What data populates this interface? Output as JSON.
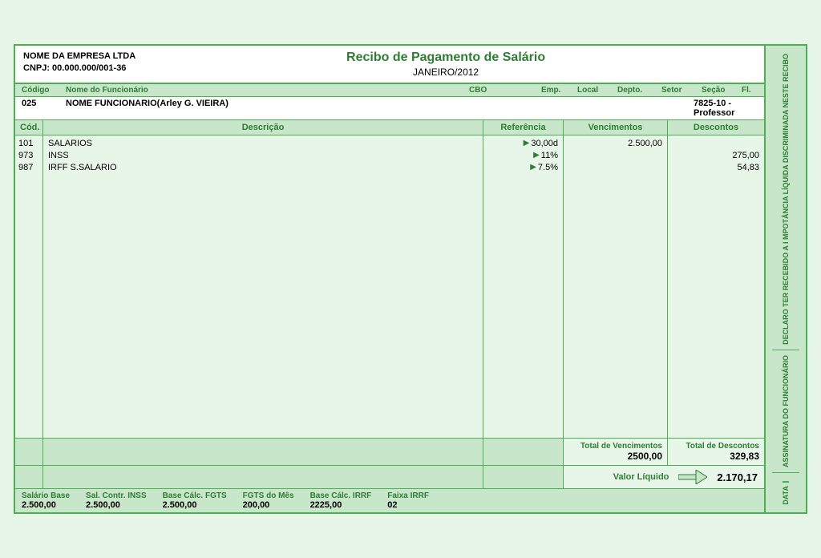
{
  "company": {
    "name": "NOME DA EMPRESA LTDA",
    "cnpj": "CNPJ: 00.000.000/001-36"
  },
  "title": "Recibo de Pagamento de Salário",
  "period": "JANEIRO/2012",
  "employee": {
    "headers": {
      "codigo": "Código",
      "nome": "Nome do Funcionário",
      "cbo": "CBO",
      "emp": "Emp.",
      "local": "Local",
      "depto": "Depto.",
      "setor": "Setor",
      "secao": "Seção",
      "fl": "Fl."
    },
    "codigo": "025",
    "nome": "NOME FUNCIONARIO(Arley G. VIEIRA)",
    "cbo": "7825-10 - Professor"
  },
  "table": {
    "headers": {
      "cod": "Cód.",
      "descricao": "Descrição",
      "referencia": "Referência",
      "vencimentos": "Vencimentos",
      "descontos": "Descontos"
    },
    "items": [
      {
        "cod": "101",
        "desc": "SALARIOS",
        "ref": "30,00d",
        "venc": "2.500,00",
        "desc_val": ""
      },
      {
        "cod": "973",
        "desc": "INSS",
        "ref": "11%",
        "venc": "",
        "desc_val": "275,00"
      },
      {
        "cod": "987",
        "desc": "IRFF S.SALARIO",
        "ref": "7.5%",
        "venc": "",
        "desc_val": "54,83"
      }
    ]
  },
  "totals": {
    "total_vencimentos_label": "Total de Vencimentos",
    "total_vencimentos_value": "2500,00",
    "total_descontos_label": "Total de Descontos",
    "total_descontos_value": "329,83",
    "valor_liquido_label": "Valor Líquido",
    "valor_liquido_value": "2.170,17"
  },
  "bottom": {
    "salario_base_label": "Salário Base",
    "salario_base_value": "2.500,00",
    "sal_contr_inss_label": "Sal. Contr. INSS",
    "sal_contr_inss_value": "2.500,00",
    "base_calc_fgts_label": "Base Cálc. FGTS",
    "base_calc_fgts_value": "2.500,00",
    "fgts_mes_label": "FGTS do Mês",
    "fgts_mes_value": "200,00",
    "base_calc_irrf_label": "Base Cálc. IRRF",
    "base_calc_irrf_value": "2225,00",
    "faixa_irrf_label": "Faixa IRRF",
    "faixa_irrf_value": "02"
  },
  "sidebar": {
    "line1": "DECLARO TER RECEBIDO A I MPOTÂNCIA LÍQUIDA DISCRIMINADA NESTE RECIBO",
    "line2": "ASSINATURA DO FUNCIONÁRIO",
    "data_label": "DATA"
  }
}
